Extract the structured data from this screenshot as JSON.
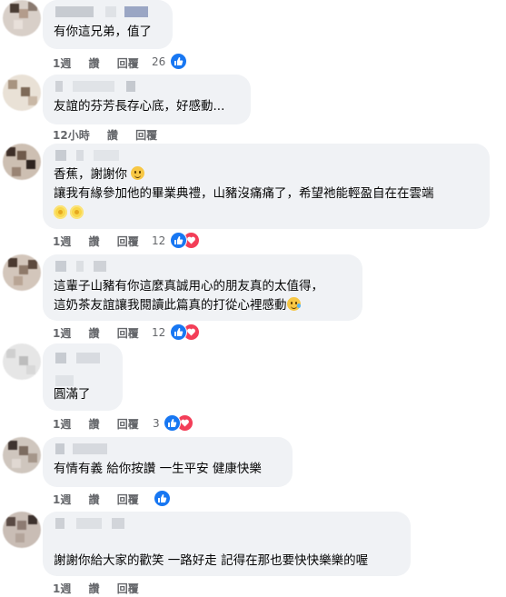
{
  "actions": {
    "week": "1週",
    "like": "讚",
    "reply": "回覆",
    "hours": "12小時"
  },
  "colors": {
    "bubble": "#f0f2f5",
    "meta": "#65676b",
    "like": "#1877f2",
    "love": "#f33e58"
  },
  "icons": {
    "like": "thumbs-up-icon",
    "love": "heart-icon",
    "smile": "smiling-face-emoji",
    "tear": "grinning-sweat-emoji",
    "sun": "sunflower-emoji"
  },
  "comments": [
    {
      "text": [
        "有你這兄弟，值了"
      ],
      "time": "1週",
      "reactions": "26"
    },
    {
      "text": [
        "友誼的芬芳長存心底，好感動..."
      ],
      "time": "12小時",
      "reactions": ""
    },
    {
      "text": [
        "香蕉，謝謝你",
        "讓我有緣參加他的畢業典禮，山豬沒痛痛了，希望祂能輕盈自在在雲端"
      ],
      "time": "1週",
      "reactions": "12"
    },
    {
      "text": [
        "這輩子山豬有你這麼真誠用心的朋友真的太值得，",
        "這奶茶友誼讓我閱讀此篇真的打從心裡感動"
      ],
      "time": "1週",
      "reactions": "12"
    },
    {
      "text": [
        "圓滿了"
      ],
      "time": "1週",
      "reactions": "3"
    },
    {
      "text": [
        "有情有義 給你按讚 一生平安 健康快樂"
      ],
      "time": "1週",
      "reactions": ""
    },
    {
      "text": [
        "謝謝你給大家的歡笑 一路好走 記得在那也要快快樂樂的喔"
      ],
      "time": "1週",
      "reactions": ""
    }
  ]
}
